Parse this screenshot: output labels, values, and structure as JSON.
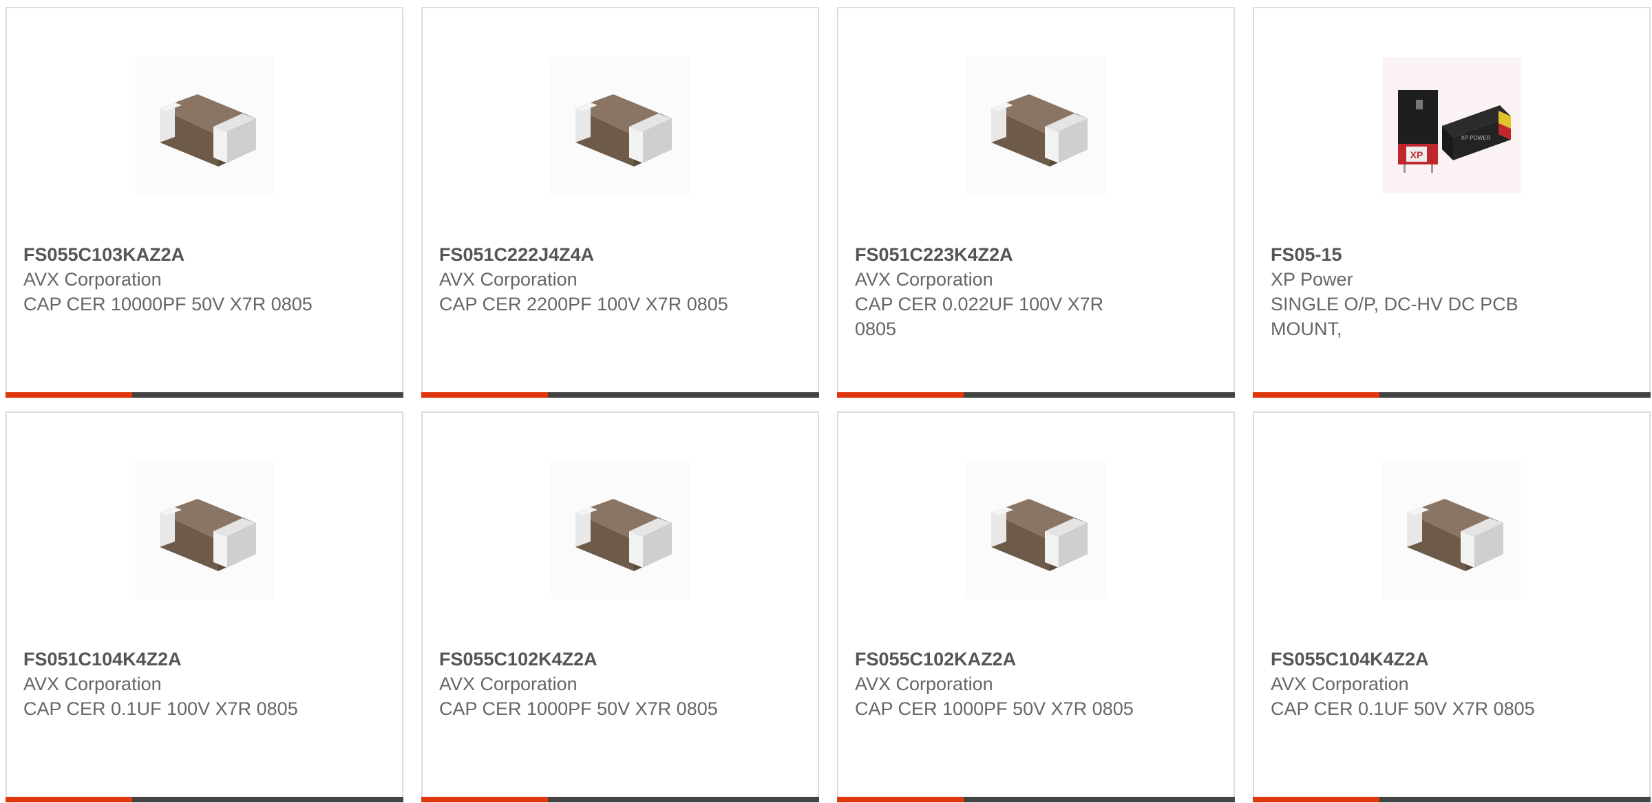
{
  "colors": {
    "accent": "#e0380c",
    "bar": "#444444",
    "border": "#dcdcdc",
    "text": "#666666"
  },
  "products": [
    {
      "part": "FS055C103KAZ2A",
      "manufacturer": "AVX Corporation",
      "description": "CAP CER 10000PF 50V X7R 0805",
      "image": "ceramic-capacitor-icon"
    },
    {
      "part": "FS051C222J4Z4A",
      "manufacturer": "AVX Corporation",
      "description": "CAP CER 2200PF 100V X7R 0805",
      "image": "ceramic-capacitor-icon"
    },
    {
      "part": "FS051C223K4Z2A",
      "manufacturer": "AVX Corporation",
      "description": "CAP CER 0.022UF 100V X7R 0805",
      "image": "ceramic-capacitor-icon"
    },
    {
      "part": "FS05-15",
      "manufacturer": "XP Power",
      "description": "SINGLE O/P, DC-HV DC PCB MOUNT,",
      "image": "power-module-icon"
    },
    {
      "part": "FS051C104K4Z2A",
      "manufacturer": "AVX Corporation",
      "description": "CAP CER 0.1UF 100V X7R 0805",
      "image": "ceramic-capacitor-icon"
    },
    {
      "part": "FS055C102K4Z2A",
      "manufacturer": "AVX Corporation",
      "description": "CAP CER 1000PF 50V X7R 0805",
      "image": "ceramic-capacitor-icon"
    },
    {
      "part": "FS055C102KAZ2A",
      "manufacturer": "AVX Corporation",
      "description": "CAP CER 1000PF 50V X7R 0805",
      "image": "ceramic-capacitor-icon"
    },
    {
      "part": "FS055C104K4Z2A",
      "manufacturer": "AVX Corporation",
      "description": "CAP CER 0.1UF 50V X7R 0805",
      "image": "ceramic-capacitor-icon"
    }
  ]
}
